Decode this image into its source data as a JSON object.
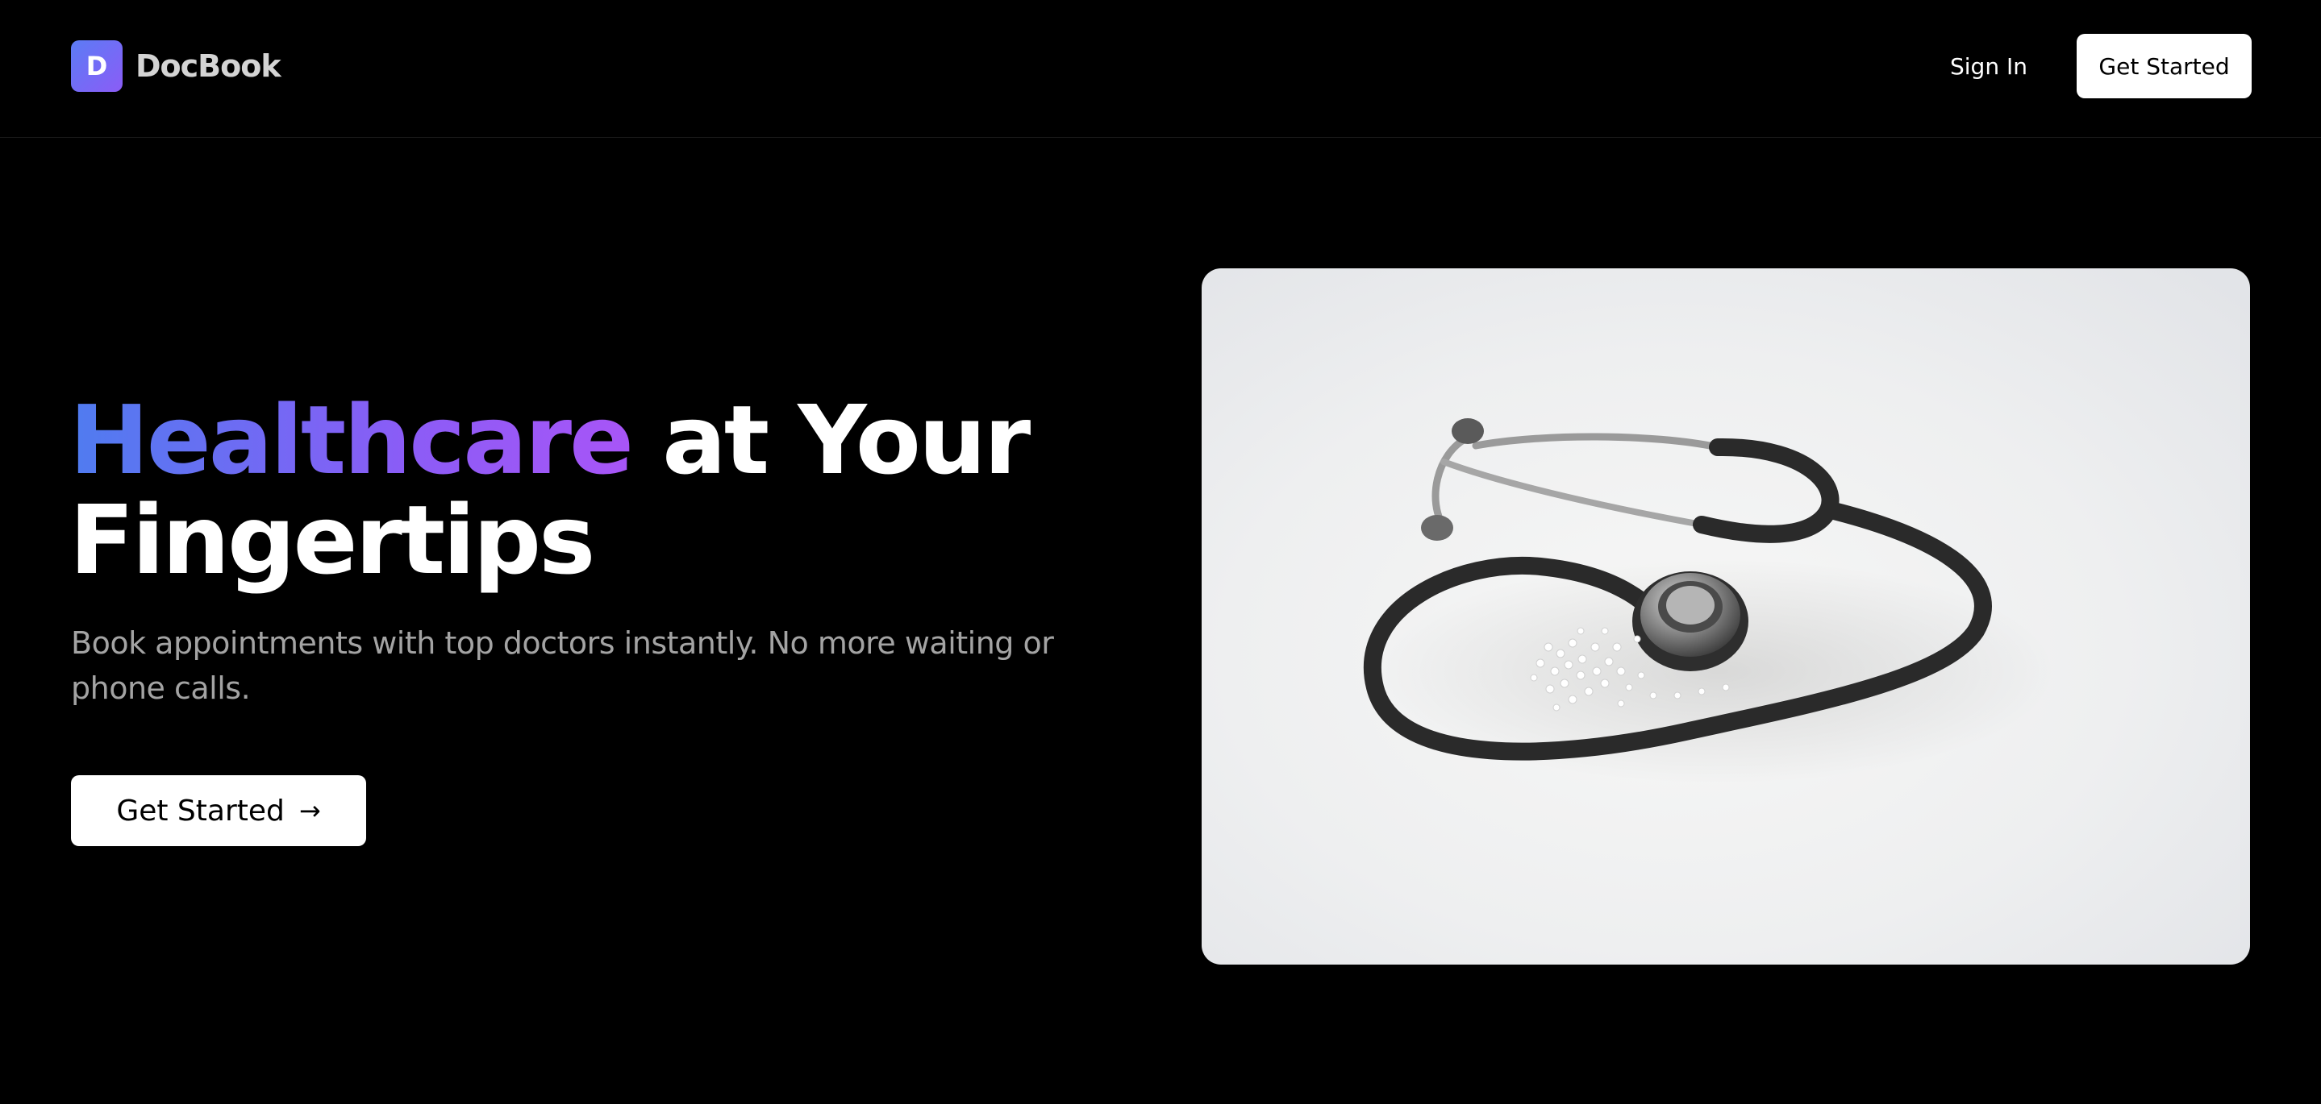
{
  "header": {
    "logo_letter": "D",
    "brand_name": "DocBook",
    "signin_label": "Sign In",
    "get_started_label": "Get Started"
  },
  "hero": {
    "title_highlight": "Healthcare",
    "title_rest": " at Your Fingertips",
    "subtitle": "Book appointments with top doctors instantly. No more waiting or phone calls.",
    "cta_label": "Get Started",
    "cta_icon": "arrow-right-icon",
    "image_subject": "stethoscope-photo"
  },
  "colors": {
    "background": "#000000",
    "gradient_start": "#4f7cf0",
    "gradient_end": "#a855f7",
    "button_bg": "#ffffff",
    "muted_text": "#a3a3a3"
  }
}
